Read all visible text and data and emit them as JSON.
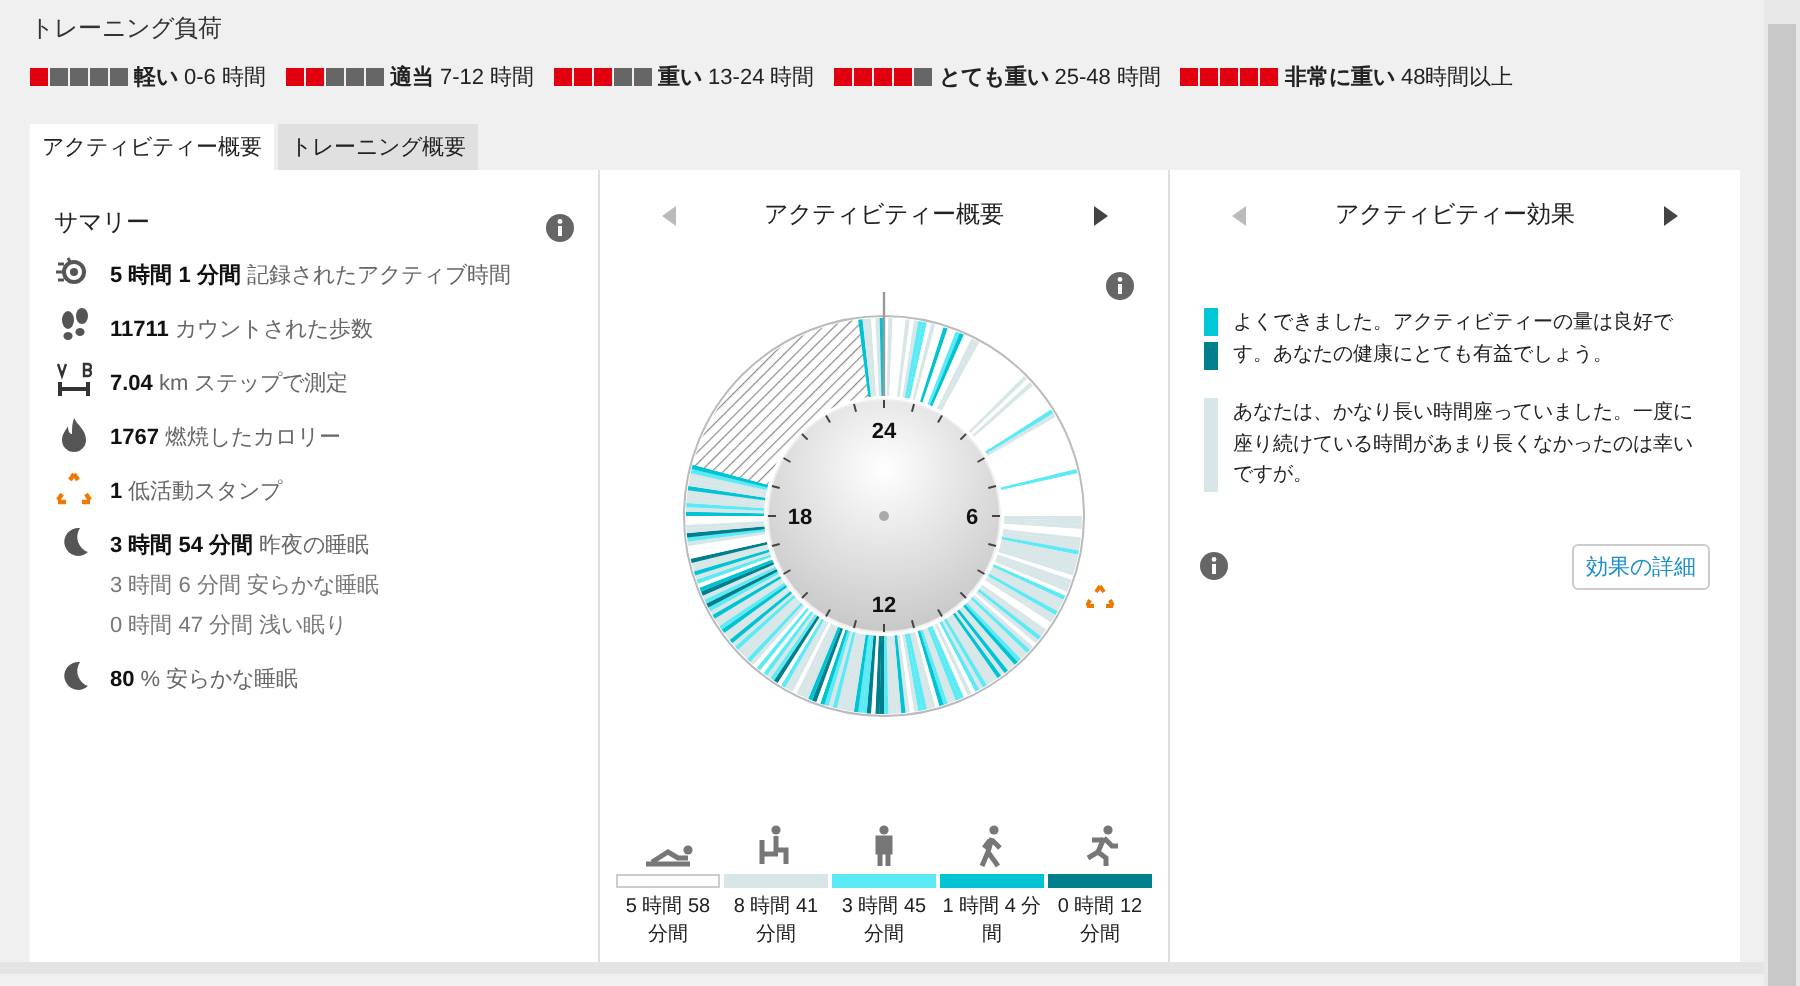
{
  "section_title": "トレーニング負荷",
  "load_levels": [
    {
      "stars": 1,
      "label": "軽い",
      "range": "0-6 時間"
    },
    {
      "stars": 2,
      "label": "適当",
      "range": "7-12 時間"
    },
    {
      "stars": 3,
      "label": "重い",
      "range": "13-24 時間"
    },
    {
      "stars": 4,
      "label": "とても重い",
      "range": "25-48 時間"
    },
    {
      "stars": 5,
      "label": "非常に重い",
      "range": "48時間以上"
    }
  ],
  "tabs": [
    {
      "label": "アクティビティー概要",
      "selected": true
    },
    {
      "label": "トレーニング概要",
      "selected": false
    }
  ],
  "summary": {
    "title": "サマリー",
    "rows": [
      {
        "kind": "active",
        "text": "**5 時間 1 分間** 記録されたアクティブ時間"
      },
      {
        "kind": "steps",
        "text": "**11711** カウントされた歩数"
      },
      {
        "kind": "distance",
        "text": "**7.04** km ステップで測定"
      },
      {
        "kind": "calories",
        "text": "**1767** 燃焼したカロリー"
      },
      {
        "kind": "stamp",
        "text": "**1** 低活動スタンプ"
      },
      {
        "kind": "sleep",
        "text": "**3 時間 54 分間** 昨夜の睡眠",
        "details": [
          "3 時間 6 分間 安らかな睡眠",
          "0 時間 47 分間 浅い眠り"
        ]
      },
      {
        "kind": "sleep",
        "text": "**80** % 安らかな睡眠"
      }
    ]
  },
  "overview": {
    "title": "アクティビティー概要",
    "clock_labels": [
      "24",
      "6",
      "12",
      "18"
    ],
    "activity_levels": [
      {
        "kind": "lying",
        "color": "#ffffff",
        "duration": "5 時間 58 分間"
      },
      {
        "kind": "sitting",
        "color": "#d8e6e8",
        "duration": "8 時間 41 分間"
      },
      {
        "kind": "standing",
        "color": "#5ceaf5",
        "duration": "3 時間 45 分間"
      },
      {
        "kind": "walking",
        "color": "#00c4d4",
        "duration": "1 時間 4 分間"
      },
      {
        "kind": "running",
        "color": "#007f8c",
        "duration": "0 時間 12 分間"
      }
    ]
  },
  "effect": {
    "title": "アクティビティー効果",
    "messages": [
      {
        "markers": [
          {
            "color": "#00c8d6"
          },
          {
            "color": "#00808c"
          }
        ],
        "text": "よくできました。アクティビティーの量は良好です。あなたの健康にとても有益でしょう。"
      },
      {
        "markers": [
          {
            "color": "#d8e6e8"
          }
        ],
        "text": "あなたは、かなり長い時間座っていました。一度に座り続けている時間があまり長くなかったのは幸いですが。"
      }
    ],
    "button": "効果の詳細"
  }
}
